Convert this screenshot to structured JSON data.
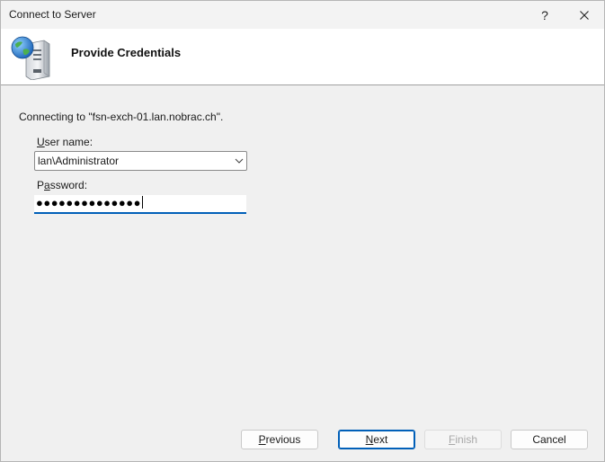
{
  "window": {
    "title": "Connect to Server",
    "help_label": "?"
  },
  "header": {
    "title": "Provide Credentials",
    "icon": "server-globe-icon"
  },
  "form": {
    "connecting_text": "Connecting to \"fsn-exch-01.lan.nobrac.ch\".",
    "username_label_key": "U",
    "username_label_rest": "ser name:",
    "username_value": "lan\\Administrator",
    "password_label_pre": "P",
    "password_label_key": "a",
    "password_label_rest": "ssword:",
    "password_mask": "●●●●●●●●●●●●●●"
  },
  "buttons": {
    "previous_key": "P",
    "previous_rest": "revious",
    "next_key": "N",
    "next_rest": "ext",
    "finish_key": "F",
    "finish_rest": "inish",
    "cancel": "Cancel"
  },
  "colors": {
    "accent": "#005fb8",
    "disabled_text": "#a8a8a8"
  }
}
